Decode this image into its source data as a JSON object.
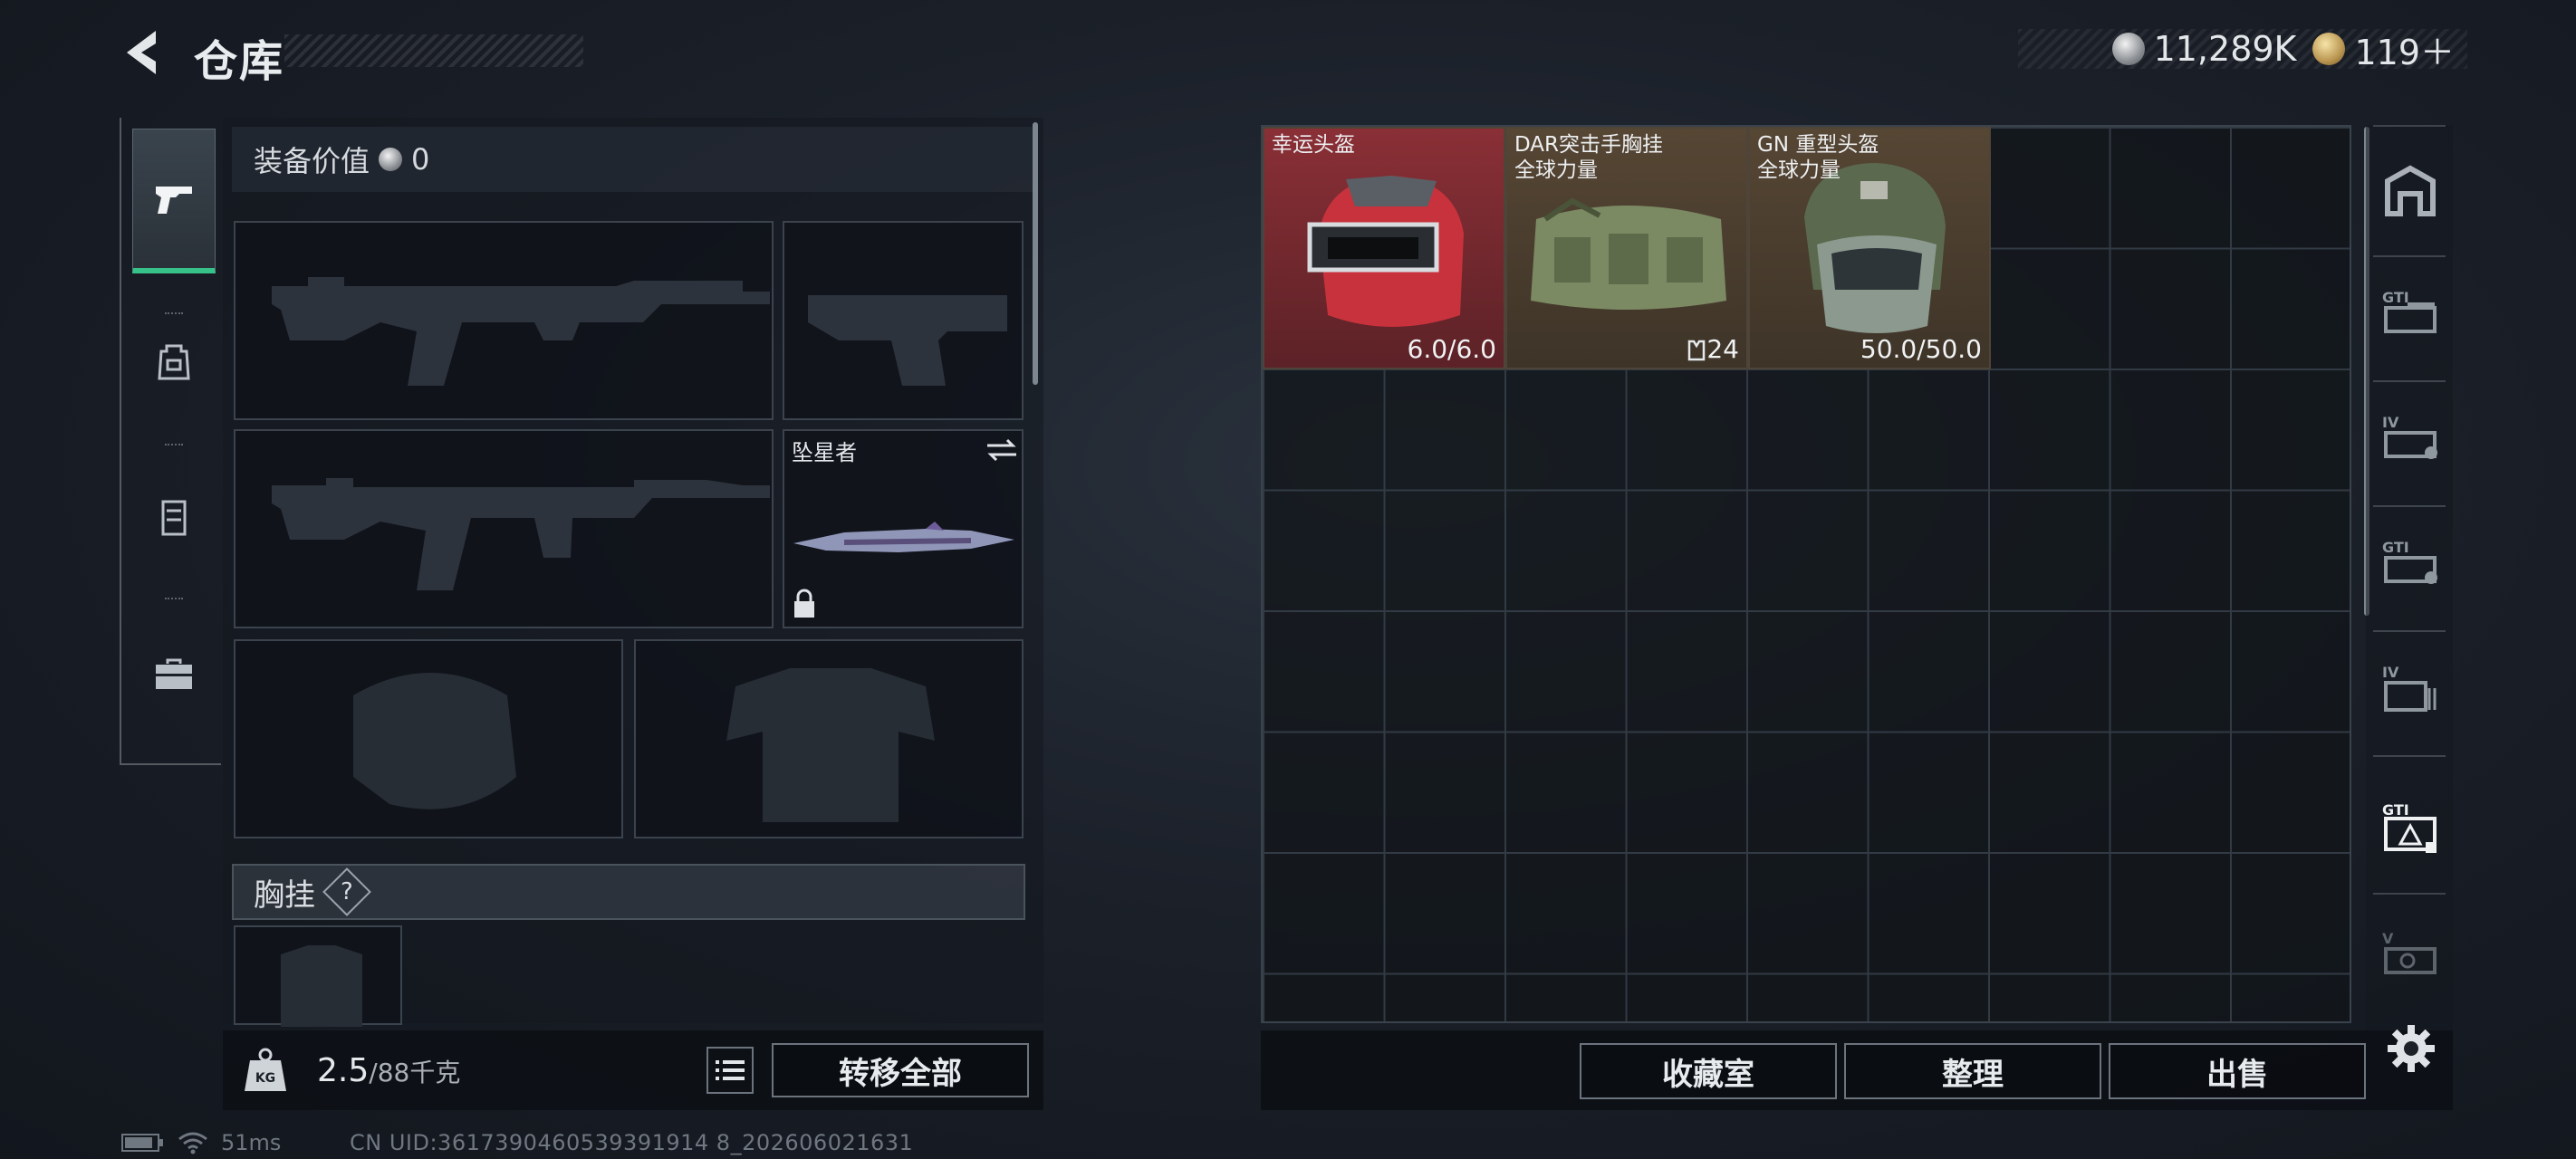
{
  "header": {
    "title": "仓库"
  },
  "currency": {
    "silver": "11,289K",
    "gold": "119＋"
  },
  "equipment": {
    "value_label": "装备价值",
    "value": "0",
    "melee_name": "坠星者",
    "chest_rig_label": "胸挂",
    "help": "?"
  },
  "weight": {
    "current": "2.5",
    "capacity": "/88千克"
  },
  "buttons": {
    "transfer_all": "转移全部",
    "collection": "收藏室",
    "organize": "整理",
    "sell": "出售"
  },
  "items": [
    {
      "name": "幸运头盔",
      "subtitle": "",
      "value": "6.0/6.0"
    },
    {
      "name": "DAR突击手胸挂",
      "subtitle": "全球力量",
      "value": "24"
    },
    {
      "name": "GN 重型头盔",
      "subtitle": "全球力量",
      "value": "50.0/50.0"
    }
  ],
  "status": {
    "ping": "51ms",
    "uid": "CN UID:3617390460539391914 8_202606021631"
  },
  "icons": {
    "back": "chevron-left-icon",
    "pistol": "pistol-icon",
    "backpack": "backpack-icon",
    "vest": "vest-icon",
    "toolbox": "toolbox-icon",
    "kg": "kg-weight-icon",
    "list": "list-icon",
    "gear": "gear-icon",
    "lock": "lock-icon",
    "swap": "swap-icon"
  },
  "colors": {
    "accent": "#37c28a",
    "rare_red": "#7a2a30",
    "rare_gold": "#5a4a34"
  }
}
